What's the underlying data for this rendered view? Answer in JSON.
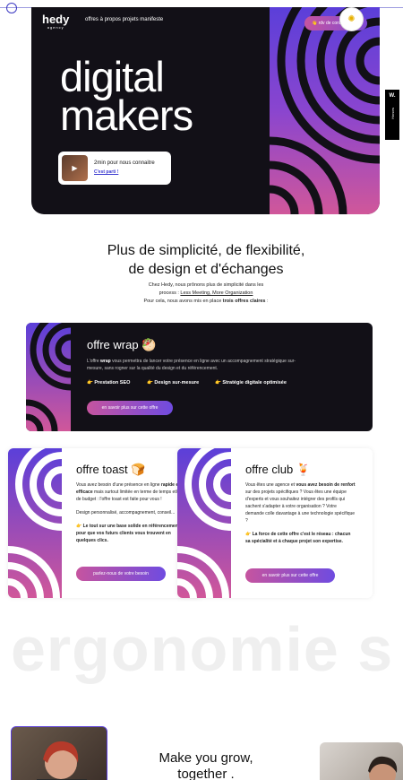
{
  "hero": {
    "logo": "hedy",
    "logo_sub": "agency",
    "nav": "offres  à propos  projets  manifeste",
    "cta": "👋 rdv de conseil gratuit",
    "title_line1": "digital",
    "title_line2": "makers",
    "card_text": "2min pour nous connaitre",
    "card_link": "C'est parti !",
    "side_tab_logo": "W.",
    "side_tab_label": "Honors"
  },
  "intro": {
    "title_line1": "Plus de simplicité, de flexibilité,",
    "title_line2": "de design et d'échanges",
    "text_line1": "Chez Hedy, nous prônons plus de simplicité dans les",
    "text_line2_pre": "process : ",
    "text_line2_link": "Less Meeting, More Organization",
    "text_line3_pre": "Pour cela, nous avons mis en place ",
    "text_line3_bold": "trois offres claires",
    "text_line3_post": " :"
  },
  "wrap": {
    "title": "offre wrap 🥙",
    "desc_pre": "L'offre ",
    "desc_bold": "wrap",
    "desc_post": " vous permettra de lancer votre présence en ligne avec un accompagnement stratégique sur-mesure, sans rogner sur la qualité du design et du référencement.",
    "feat1": "👉 Prestation SEO",
    "feat2": "👉 Design sur-mesure",
    "feat3": "👉 Stratégie digitale optimisée",
    "button": "en savoir plus sur cette offre"
  },
  "toast": {
    "title": "offre toast 🍞",
    "p1_a": "Vous avez besoin d'une présence en ligne ",
    "p1_b": "rapide et efficace",
    "p1_c": " mais surtout limitée en terme de temps et/ou de budget : l'offre toast est faite pour vous !",
    "p2": "Design personnalisé, accompagnement, conseil...",
    "p3": "👉 Le tout sur une base solide en référencement pour que vos futurs clients vous trouvent en quelques clics.",
    "button": "parlez-nous de votre besoin"
  },
  "club": {
    "title": "offre club 🍹",
    "p1_a": "Vous êtes une agence et ",
    "p1_b": "vous avez besoin de renfort",
    "p1_c": " sur des projets spécifiques ? Vous êtes une équipe d'experts et vous souhaitez intégrer des profils qui sachent s'adapter à votre organisation ? Votre demande colle davantage à une technologie spécifique ?",
    "p2": "👉 La force de cette offre c'est le réseau : chacun sa spécialité et à chaque projet son expertise.",
    "button": "en savoir plus sur cette offre"
  },
  "banner": {
    "word": "ergonomie s"
  },
  "bottom": {
    "title_line1": "Make you grow,",
    "title_line2": "together ."
  },
  "colors": {
    "dark": "#121017",
    "gradient_start": "#5b3fd9",
    "gradient_end": "#d0579a",
    "accent_blue": "#3b3ad0"
  }
}
